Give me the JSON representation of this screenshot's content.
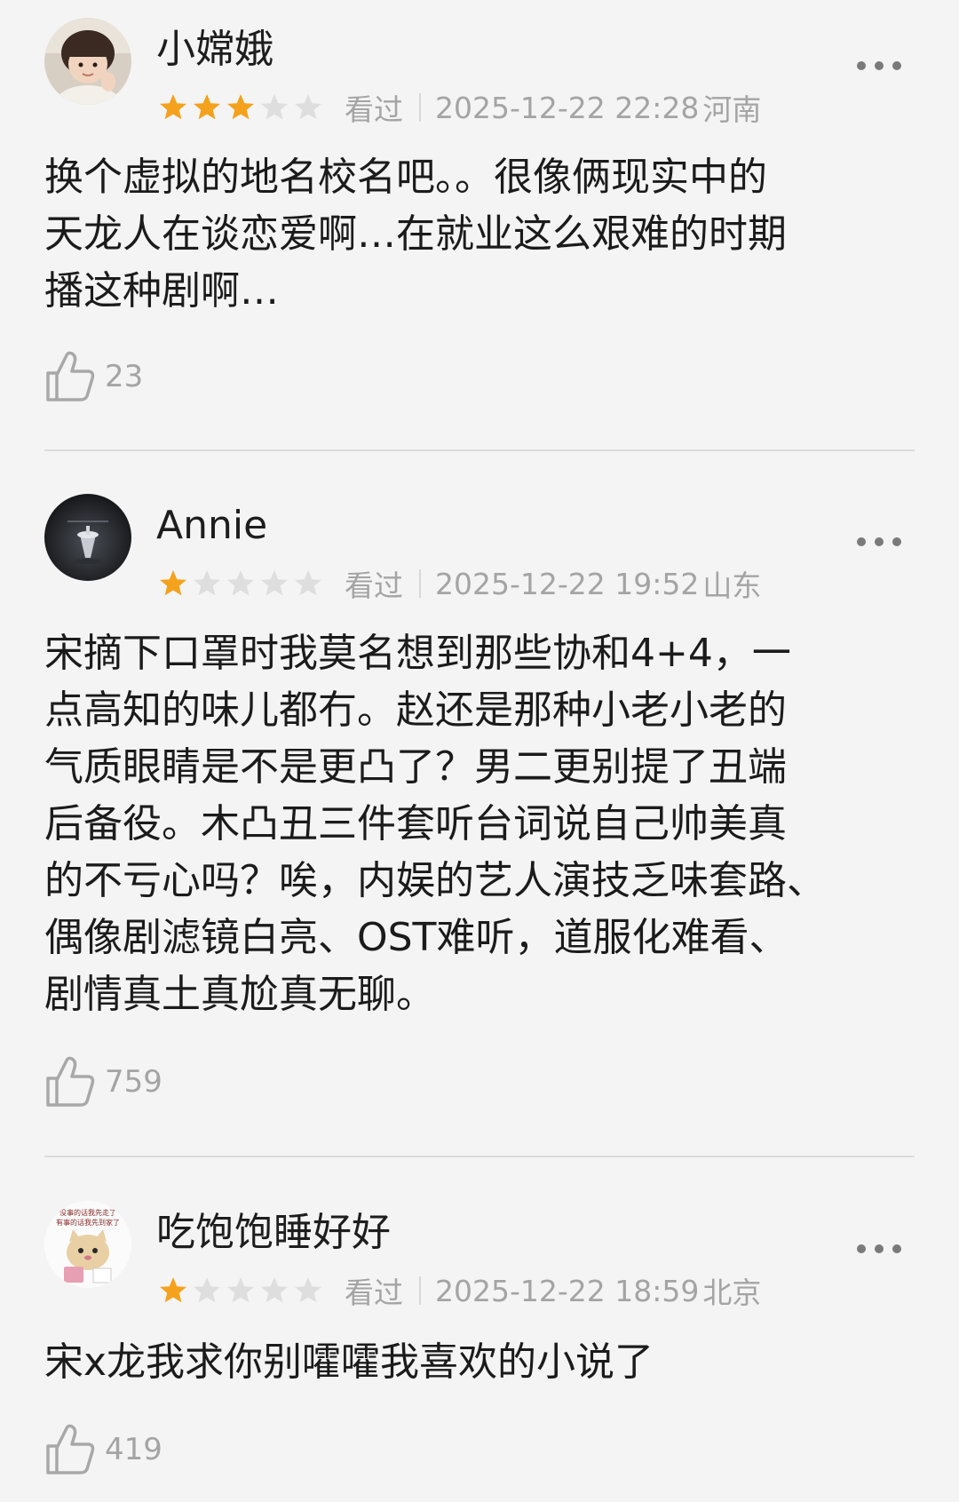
{
  "colors": {
    "star_filled": "#f4a21e",
    "star_empty": "#dedede",
    "meta_text": "#a4a4a4",
    "main_text": "#1b1b1b",
    "background": "#f4f4f4"
  },
  "comments": [
    {
      "username": "小嫦娥",
      "rating": 3,
      "rating_max": 5,
      "status": "看过",
      "datetime": "2025-12-22 22:28",
      "location": "河南",
      "lines": [
        "换个虚拟的地名校名吧。。很像俩现实中的",
        "天龙人在谈恋爱啊…在就业这么艰难的时期",
        "播这种剧啊…"
      ],
      "likes": "23",
      "avatar_icon": "child-photo-avatar"
    },
    {
      "username": "Annie",
      "rating": 1,
      "rating_max": 5,
      "status": "看过",
      "datetime": "2025-12-22 19:52",
      "location": "山东",
      "lines": [
        "宋摘下口罩时我莫名想到那些协和4+4，一",
        "点高知的味儿都冇。赵还是那种小老小老的",
        "气质眼睛是不是更凸了？男二更别提了丑端",
        "后备役。木凸丑三件套听台词说自己帅美真",
        "的不亏心吗？唉，内娱的艺人演技乏味套路、",
        "偶像剧滤镜白亮、OST难听，道服化难看、",
        "剧情真土真尬真无聊。"
      ],
      "likes": "759",
      "avatar_icon": "spinning-top-avatar"
    },
    {
      "username": "吃饱饱睡好好",
      "rating": 1,
      "rating_max": 5,
      "status": "看过",
      "datetime": "2025-12-22 18:59",
      "location": "北京",
      "lines": [
        "宋x龙我求你别嚯嚯我喜欢的小说了"
      ],
      "likes": "419",
      "avatar_icon": "cat-meme-avatar",
      "avatar_text": [
        "没事的话我先走了",
        "有事的话我先到家了"
      ]
    }
  ]
}
